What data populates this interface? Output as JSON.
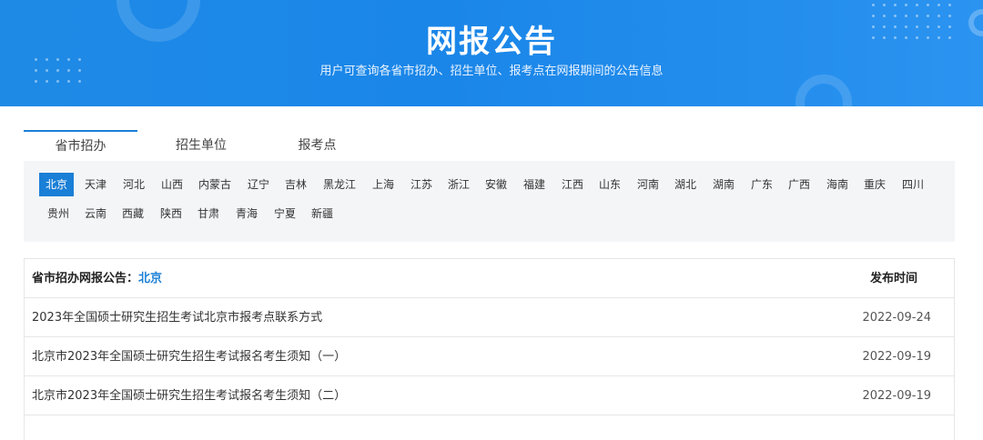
{
  "banner": {
    "title": "网报公告",
    "subtitle": "用户可查询各省市招办、招生单位、报考点在网报期间的公告信息"
  },
  "tabs": [
    {
      "label": "省市招办",
      "active": true
    },
    {
      "label": "招生单位",
      "active": false
    },
    {
      "label": "报考点",
      "active": false
    }
  ],
  "provinces": {
    "selected": "北京",
    "row1": [
      "北京",
      "天津",
      "河北",
      "山西",
      "内蒙古",
      "辽宁",
      "吉林",
      "黑龙江",
      "上海",
      "江苏",
      "浙江",
      "安徽",
      "福建",
      "江西",
      "山东",
      "河南",
      "湖北",
      "湖南",
      "广东",
      "广西",
      "海南",
      "重庆",
      "四川"
    ],
    "row2": [
      "贵州",
      "云南",
      "西藏",
      "陕西",
      "甘肃",
      "青海",
      "宁夏",
      "新疆"
    ]
  },
  "table": {
    "header_prefix": "省市招办网报公告：",
    "header_region": "北京",
    "date_header": "发布时间",
    "rows": [
      {
        "title": "2023年全国硕士研究生招生考试北京市报考点联系方式",
        "date": "2022-09-24"
      },
      {
        "title": "北京市2023年全国硕士研究生招生考试报名考生须知（一）",
        "date": "2022-09-19"
      },
      {
        "title": "北京市2023年全国硕士研究生招生考试报名考生须知（二）",
        "date": "2022-09-19"
      }
    ]
  },
  "colors": {
    "banner_blue": "#1a86e8",
    "accent": "#1a7fd6",
    "panel_bg": "#f4f5f7"
  }
}
